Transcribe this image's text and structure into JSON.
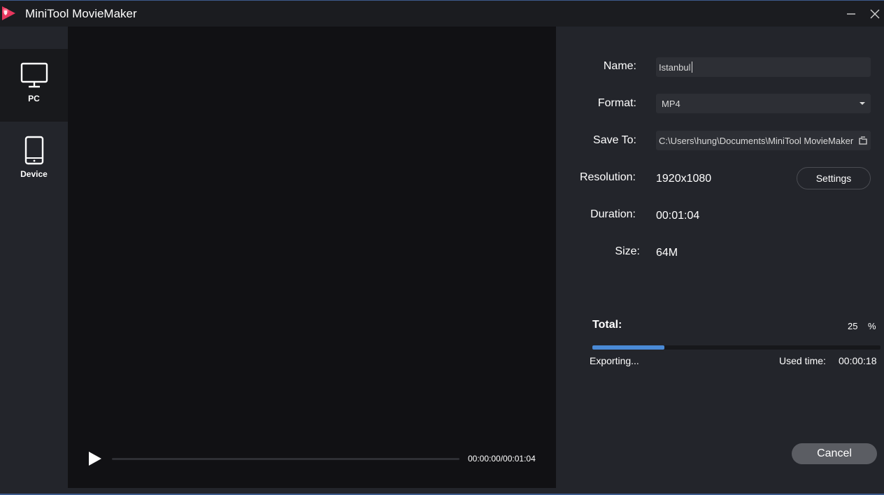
{
  "window": {
    "title": "MiniTool MovieMaker"
  },
  "sidebar": {
    "items": [
      {
        "label": "PC",
        "icon": "monitor-icon",
        "active": true
      },
      {
        "label": "Device",
        "icon": "phone-icon",
        "active": false
      }
    ]
  },
  "preview": {
    "time": "00:00:00/00:01:04"
  },
  "export": {
    "name_label": "Name:",
    "name_value": "Istanbul",
    "format_label": "Format:",
    "format_value": "MP4",
    "save_label": "Save To:",
    "save_value": "C:\\Users\\hung\\Documents\\MiniTool MovieMaker",
    "resolution_label": "Resolution:",
    "resolution_value": "1920x1080",
    "settings_label": "Settings",
    "duration_label": "Duration:",
    "duration_value": "00:01:04",
    "size_label": "Size:",
    "size_value": "64M"
  },
  "progress": {
    "total_label": "Total:",
    "percent_value": "25",
    "percent_sign": "%",
    "fraction": 0.25,
    "status": "Exporting...",
    "used_time_label": "Used time:",
    "used_time_value": "00:00:18"
  },
  "actions": {
    "cancel_label": "Cancel"
  },
  "colors": {
    "accent": "#4a8ad6",
    "logo": "#e8365d"
  }
}
